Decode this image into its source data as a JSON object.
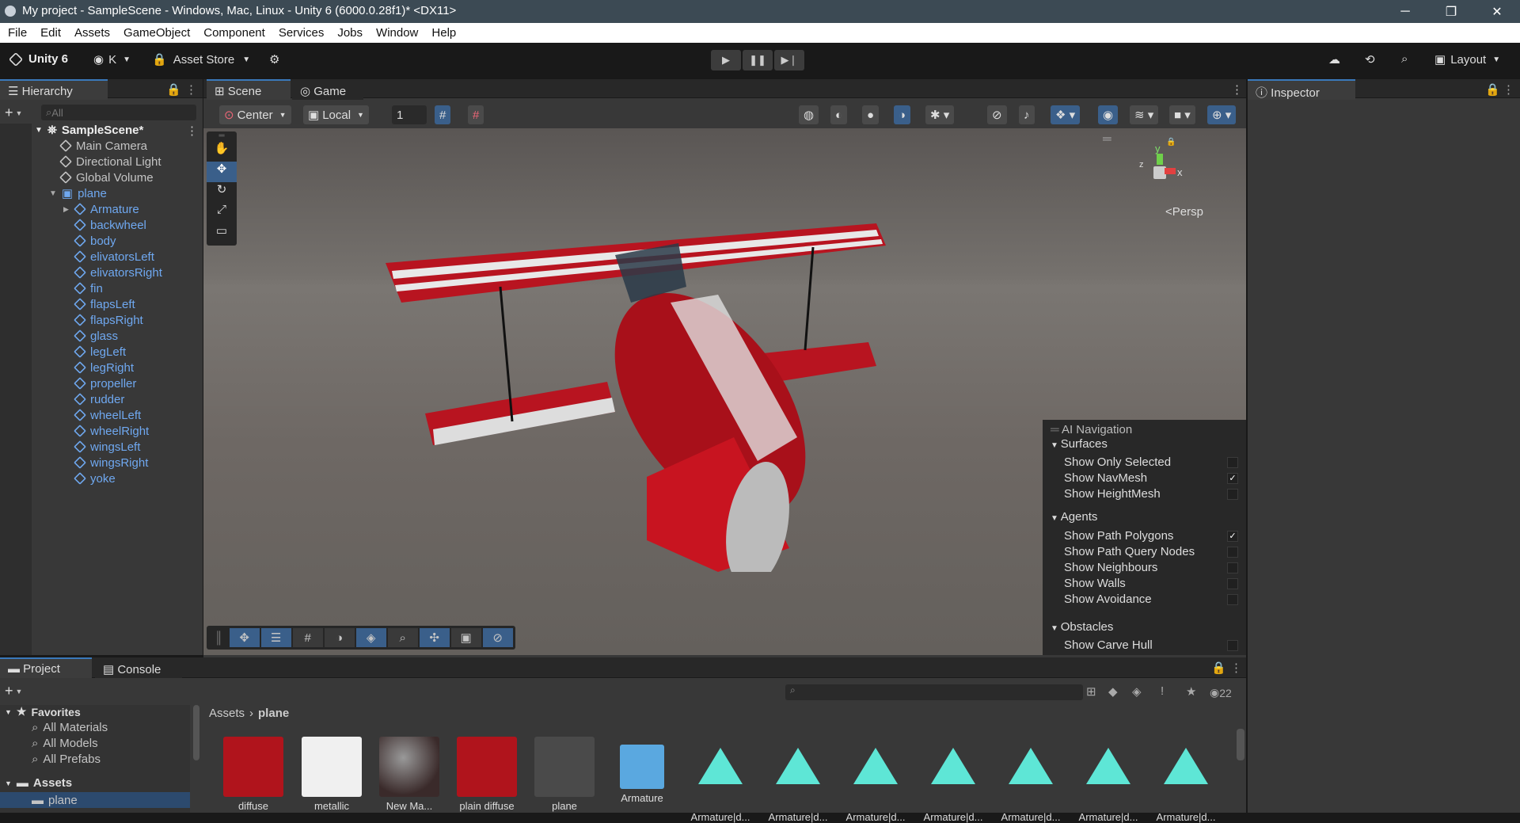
{
  "titlebar": {
    "title": "My project - SampleScene - Windows, Mac, Linux - Unity 6 (6000.0.28f1)* <DX11>"
  },
  "menu": [
    "File",
    "Edit",
    "Assets",
    "GameObject",
    "Component",
    "Services",
    "Jobs",
    "Window",
    "Help"
  ],
  "toolbar": {
    "unity": "Unity 6",
    "account": "K",
    "store": "Asset Store",
    "layout": "Layout"
  },
  "hierarchy": {
    "title": "Hierarchy",
    "search_placeholder": "All",
    "scene": "SampleScene*",
    "items": [
      "Main Camera",
      "Directional Light",
      "Global Volume"
    ],
    "root": "plane",
    "children": [
      "Armature",
      "backwheel",
      "body",
      "elivatorsLeft",
      "elivatorsRight",
      "fin",
      "flapsLeft",
      "flapsRight",
      "glass",
      "legLeft",
      "legRight",
      "propeller",
      "rudder",
      "wheelLeft",
      "wheelRight",
      "wingsLeft",
      "wingsRight",
      "yoke"
    ]
  },
  "scene": {
    "tab_scene": "Scene",
    "tab_game": "Game",
    "pivot": "Center",
    "space": "Local",
    "grid_value": "1",
    "persp": "Persp",
    "gizmo_y": "y",
    "gizmo_x": "x",
    "gizmo_z": "z"
  },
  "ainav": {
    "title": "AI Navigation",
    "surfaces": "Surfaces",
    "agents": "Agents",
    "obstacles": "Obstacles",
    "surface_items": [
      {
        "label": "Show Only Selected",
        "checked": false
      },
      {
        "label": "Show NavMesh",
        "checked": true
      },
      {
        "label": "Show HeightMesh",
        "checked": false
      }
    ],
    "agent_items": [
      {
        "label": "Show Path Polygons",
        "checked": true
      },
      {
        "label": "Show Path Query Nodes",
        "checked": false
      },
      {
        "label": "Show Neighbours",
        "checked": false
      },
      {
        "label": "Show Walls",
        "checked": false
      },
      {
        "label": "Show Avoidance",
        "checked": false
      }
    ],
    "obstacle_items": [
      {
        "label": "Show Carve Hull",
        "checked": false
      }
    ]
  },
  "inspector": {
    "title": "Inspector"
  },
  "project": {
    "tab_project": "Project",
    "tab_console": "Console",
    "count": "22",
    "breadcrumb_root": "Assets",
    "breadcrumb_current": "plane",
    "favorites": "Favorites",
    "fav_items": [
      "All Materials",
      "All Models",
      "All Prefabs"
    ],
    "assets": "Assets",
    "assets_child": "plane",
    "assets_list": [
      "diffuse",
      "metallic",
      "New Ma...",
      "plain diffuse",
      "plane",
      "Armature",
      "Armature|d...",
      "Armature|d...",
      "Armature|d...",
      "Armature|d...",
      "Armature|d...",
      "Armature|d...",
      "Armature|d..."
    ]
  },
  "colors": {
    "accent": "#3a79bb",
    "selection_blue": "#6fa8f0",
    "plane_red": "#c81420",
    "anim_cyan": "#5ee6d6"
  }
}
